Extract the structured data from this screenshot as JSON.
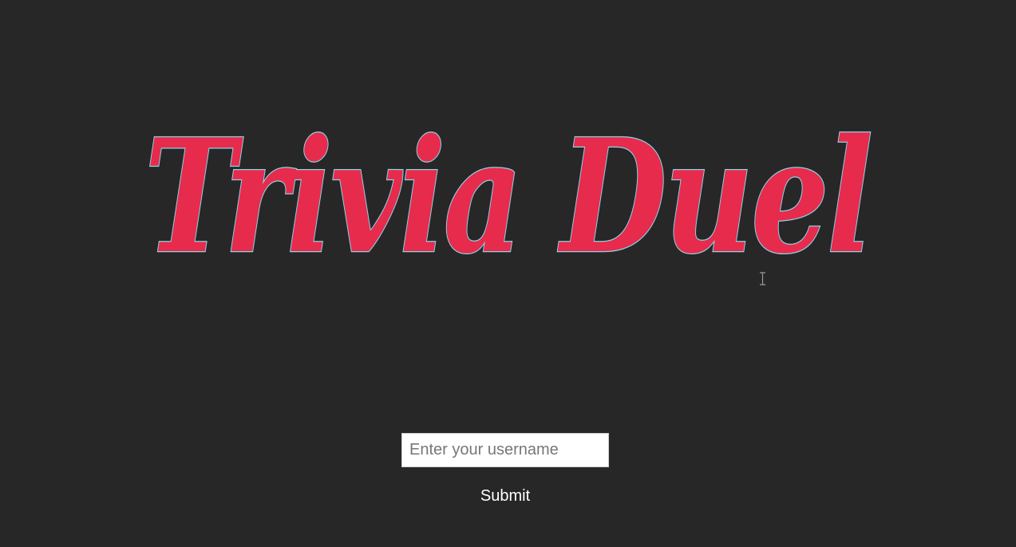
{
  "logo": {
    "text": "Trivia Duel",
    "fill_color": "#e62b4c",
    "outline_color": "#8ed3e6"
  },
  "form": {
    "username_placeholder": "Enter your username",
    "username_value": "",
    "submit_label": "Submit"
  },
  "colors": {
    "background": "#272727",
    "button_text": "#ffffff"
  },
  "cursor": {
    "icon": "text-cursor-icon"
  }
}
